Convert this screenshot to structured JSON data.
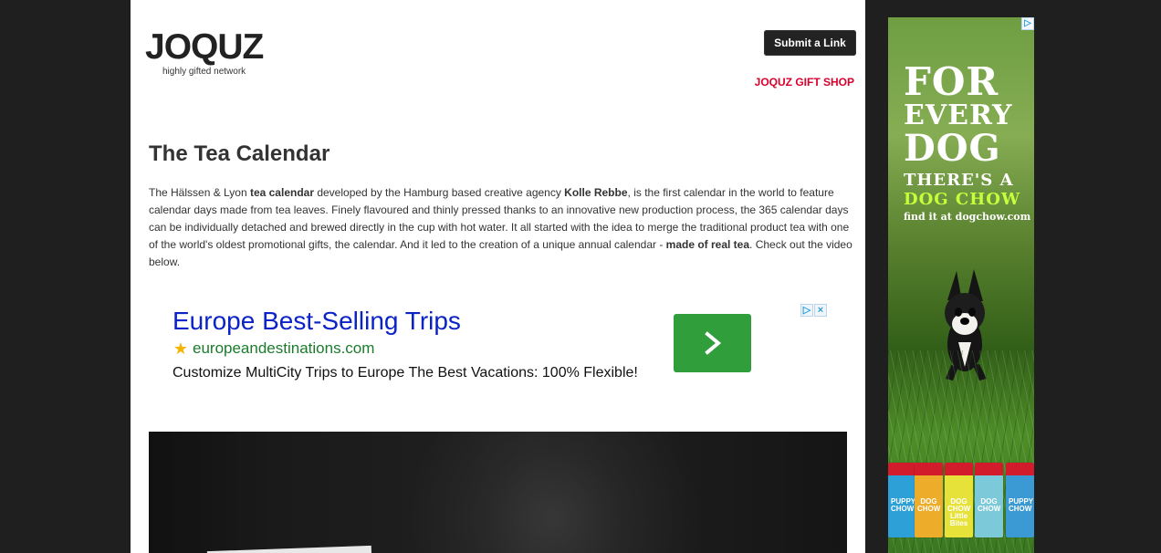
{
  "header": {
    "logo_text": "JOQUZ",
    "logo_tagline": "highly gifted network",
    "submit_label": "Submit a Link",
    "gift_shop_label": "JOQUZ GIFT SHOP"
  },
  "article": {
    "title": "The Tea Calendar",
    "body": {
      "p1": "The Hälssen & Lyon ",
      "b1": "tea calendar",
      "p2": " developed by the Hamburg based creative agency ",
      "b2": "Kolle Rebbe",
      "p3": ", is the first calendar in the world to feature calendar days made from tea leaves. Finely flavoured and thinly pressed thanks to an innovative new production process, the 365 calendar days can be individually detached and brewed directly in the cup with hot water. It all started with the idea to merge the traditional product tea with one of the world's oldest promotional gifts, the calendar. And it led to the creation of a unique annual calendar - ",
      "b3": "made of real tea",
      "p4": ". Check out the video below."
    }
  },
  "ad_unit": {
    "title": "Europe Best-Selling Trips",
    "url": "europeandestinations.com",
    "description": "Customize MultiCity Trips to Europe The Best Vacations: 100% Flexible!",
    "adchoice_icons": [
      "play-icon",
      "close-icon"
    ],
    "cta_icon": "chevron-right-icon",
    "cta_color": "#2f9e3b"
  },
  "side_ad": {
    "line1": "FOR",
    "line2": "EVERY",
    "line3": "DOG",
    "line4": "THERE'S A",
    "line5": "DOG CHOW",
    "line6": "find it at dogchow.com",
    "bags": [
      {
        "label": "PUPPY CHOW"
      },
      {
        "label": "DOG CHOW"
      },
      {
        "label": "DOG CHOW Little Bites"
      },
      {
        "label": "DOG CHOW"
      },
      {
        "label": "PUPPY CHOW"
      }
    ],
    "close_icon": "adchoices-icon"
  },
  "colors": {
    "page_background": "#1f1f1f",
    "content_background": "#ffffff",
    "gift_shop": "#d9002b",
    "ad_link": "#0b23c7",
    "ad_url": "#1b7b2c"
  }
}
